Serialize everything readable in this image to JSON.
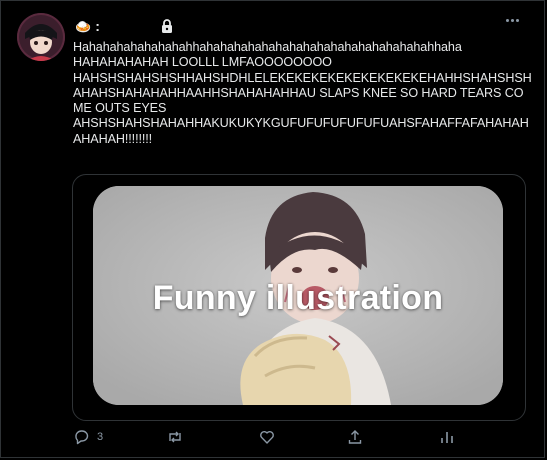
{
  "tweet": {
    "display_name_emoji": "🍛",
    "display_name_suffix": ":",
    "text": "Hahahahahahahahahhahahahahahahahahahahahahahahahahahhaha\nHAHAHAHAHAH LOOLLL LMFAOOOOOOOO\nHAHSHSHAHSHSHHAHSHDHLELEKEKEKEKEKEKEKEKEKEHAHHSHAHSHSHAHAHSHAHAHAHHAAHHSHAHAHAHHAU SLAPS KNEE SO HARD TEARS COME OUTS EYES\nAHSHSHAHSHAHAHHAKUKUKYKGUFUFUFUFUFUFUAHSFAHAFFAFAHAHAHAHAHAH!!!!!!!!",
    "media_caption": "Funny illustration",
    "reply_count": "3"
  },
  "icons": {
    "reply": "reply-icon",
    "retweet": "retweet-icon",
    "like": "heart-icon",
    "share": "share-icon",
    "analytics": "analytics-icon",
    "more": "more-icon",
    "lock": "lock-icon"
  },
  "colors": {
    "background": "#000000",
    "text": "#e7e9ea",
    "muted": "#8b98a5",
    "border": "#2f3336"
  }
}
